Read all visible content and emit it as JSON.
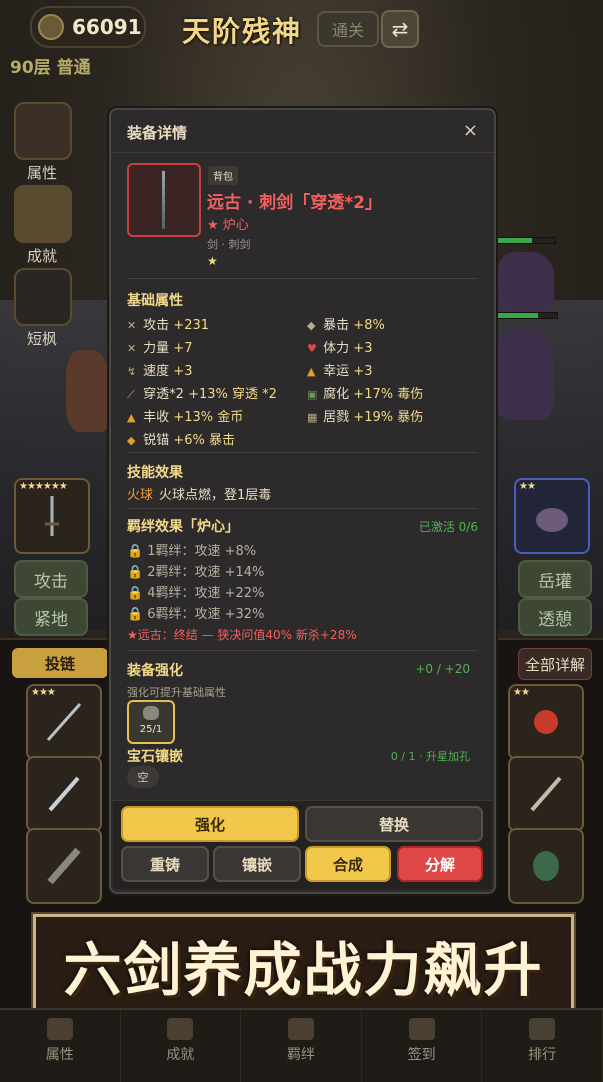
{
  "header": {
    "coins": "66091",
    "title": "天阶残神",
    "clear_label": "通关",
    "swap_icon": "swap-arrows-icon",
    "floor": "90层 普通"
  },
  "side_menu": [
    {
      "label": "属性"
    },
    {
      "label": "成就"
    },
    {
      "label": "短枫"
    }
  ],
  "battle_actions": [
    {
      "label": "攻击"
    },
    {
      "label": "紧地"
    },
    {
      "label": "岳瓘"
    },
    {
      "label": "透憩"
    }
  ],
  "bag": {
    "tab_left": "投链",
    "tab_right": "全部详解"
  },
  "modal": {
    "title": "装备详情",
    "close": "×",
    "badge": "背包",
    "item_name": "远古 · 刺剑「穿透*2」",
    "heart_tag": "★ 炉心",
    "item_type": "剑 · 刺剑",
    "item_stars": "★",
    "base_title": "基础属性",
    "attrs": [
      {
        "icon": "✕",
        "label": "攻击",
        "value": "+231"
      },
      {
        "icon": "◆",
        "label": "暴击",
        "value": "+8%"
      },
      {
        "icon": "✕",
        "label": "力量",
        "value": "+7"
      },
      {
        "icon": "♥",
        "label": "体力",
        "value": "+3"
      },
      {
        "icon": "↯",
        "label": "速度",
        "value": "+3"
      },
      {
        "icon": "▲",
        "label": "幸运",
        "value": "+3"
      },
      {
        "icon": "⟋",
        "label": "穿透*2",
        "value": "+13% 穿透 *2"
      },
      {
        "icon": "▣",
        "label": "腐化",
        "value": "+17% 毒伤"
      },
      {
        "icon": "▲",
        "label": "丰收",
        "value": "+13% 金币"
      },
      {
        "icon": "▦",
        "label": "居戮",
        "value": "+19% 暴伤"
      },
      {
        "icon": "◆",
        "label": "锐锚",
        "value": "+6% 暴击"
      }
    ],
    "skill_title": "技能效果",
    "skill_name": "火球",
    "skill_desc": "火球点燃，登1层毒",
    "bond_title": "羁绊效果「炉心」",
    "bond_status": "已激活 0/6",
    "bonds": [
      {
        "text": "1羁绊：攻速 +8%"
      },
      {
        "text": "2羁绊：攻速 +14%"
      },
      {
        "text": "4羁绊：攻速 +22%"
      },
      {
        "text": "6羁绊：攻速 +32%"
      }
    ],
    "bond_extra": "★远古：终结 — 狭决问值40% 新杀+28%",
    "enhance_title": "装备强化",
    "enhance_value": "+0 / +20",
    "enhance_desc": "强化可提升基础属性",
    "enhance_count": "25/1",
    "gem_title": "宝石镶嵌",
    "gem_value": "0 / 1 · 升星加孔",
    "gem_empty": "空",
    "btn_enhance": "强化",
    "btn_replace": "替换",
    "btn_recast": "重铸",
    "btn_inlay": "镶嵌",
    "btn_combine": "合成",
    "btn_decompose": "分解"
  },
  "banner": "六剑养成战力飙升",
  "bottom_tabs": [
    {
      "label": "属性"
    },
    {
      "label": "成就"
    },
    {
      "label": "羁绊"
    },
    {
      "label": "签到"
    },
    {
      "label": "排行"
    }
  ],
  "colors": {
    "accent_gold": "#f2c84a",
    "danger_red": "#e04848",
    "item_red": "#f26060",
    "active_green": "#4fb44f"
  }
}
